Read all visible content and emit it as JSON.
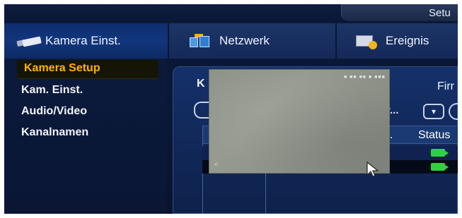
{
  "window": {
    "title": "Setu"
  },
  "menubar": {
    "tabs": [
      {
        "label": "Kamera Einst.",
        "icon": "camera-icon",
        "active": true
      },
      {
        "label": "Netzwerk",
        "icon": "network-icon",
        "active": false
      },
      {
        "label": "Ereignis",
        "icon": "event-icon",
        "active": false
      }
    ]
  },
  "sidebar": {
    "items": [
      {
        "label": "Kamera Setup",
        "selected": true
      },
      {
        "label": "Kam. Einst.",
        "selected": false
      },
      {
        "label": "Audio/Video",
        "selected": false
      },
      {
        "label": "Kanalnamen",
        "selected": false
      }
    ]
  },
  "content": {
    "panel_label": "K",
    "header_right": "Firr",
    "combo_text": "r...",
    "combo_arrow": "▾",
    "table": {
      "columns": [
        ".",
        "Status"
      ],
      "rows": [
        {
          "status": "camera-online-icon"
        },
        {
          "status": "camera-online-icon"
        }
      ]
    }
  },
  "preview": {
    "osd_text": "■ ■■ ■■ ■ ■■■",
    "corner_text": "<"
  },
  "colors": {
    "accent": "#ffb400",
    "status_ok": "#2fd23a",
    "menu_bg": "#1c3566"
  }
}
